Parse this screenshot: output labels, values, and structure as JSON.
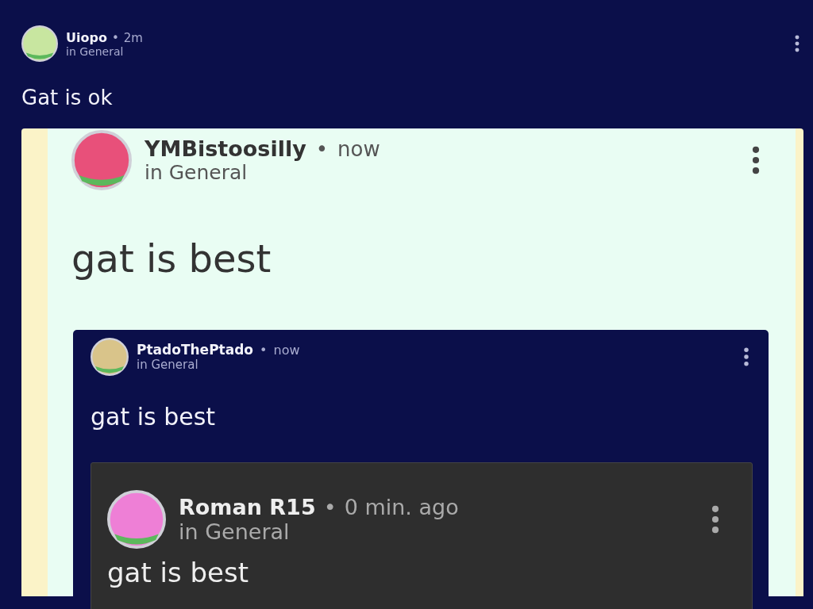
{
  "post": {
    "author": "Uiopo",
    "separator": "•",
    "time": "2m",
    "channel": "in General",
    "text": "Gat is ok",
    "kind": "navy",
    "embed": {
      "author": "YMBistoosilly",
      "separator": "•",
      "time": "now",
      "channel": "in General",
      "text": "gat is best",
      "kind": "light",
      "embed": {
        "author": "PtadoThePtado",
        "separator": "•",
        "time": "now",
        "channel": "in General",
        "text": "gat is best",
        "kind": "navy",
        "embed": {
          "author": "Roman R15",
          "separator": "•",
          "time": "0 min. ago",
          "channel": "in General",
          "text": "gat is best",
          "kind": "charcoal"
        }
      }
    }
  }
}
